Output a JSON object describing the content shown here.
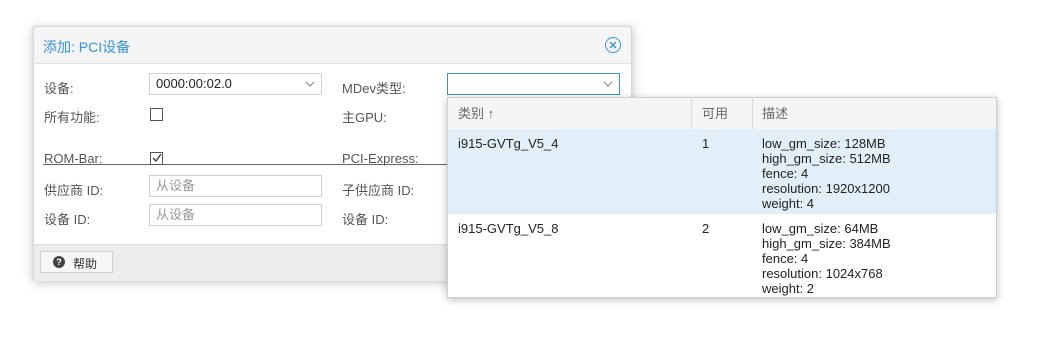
{
  "dialog": {
    "title": "添加: PCI设备",
    "fields": {
      "device_label": "设备:",
      "device_value": "0000:00:02.0",
      "all_functions_label": "所有功能:",
      "mdev_type_label": "MDev类型:",
      "primary_gpu_label": "主GPU:",
      "rom_bar_label": "ROM-Bar:",
      "pci_express_label": "PCI-Express:",
      "vendor_id_label": "供应商 ID:",
      "vendor_id_placeholder": "从设备",
      "subvendor_id_label": "子供应商 ID:",
      "device_id_label": "设备 ID:",
      "device_id_placeholder": "从设备",
      "subdevice_id_label": "设备 ID:"
    },
    "checks": {
      "all_functions": false,
      "rom_bar": true
    },
    "footer": {
      "help_label": "帮助"
    }
  },
  "mdev_dropdown": {
    "columns": [
      "类别 ↑",
      "可用",
      "描述"
    ],
    "rows": [
      {
        "type": "i915-GVTg_V5_4",
        "available": "1",
        "description": [
          "low_gm_size: 128MB",
          "high_gm_size: 512MB",
          "fence: 4",
          "resolution: 1920x1200",
          "weight: 4"
        ],
        "selected": true
      },
      {
        "type": "i915-GVTg_V5_8",
        "available": "2",
        "description": [
          "low_gm_size: 64MB",
          "high_gm_size: 384MB",
          "fence: 4",
          "resolution: 1024x768",
          "weight: 2"
        ],
        "selected": false
      }
    ]
  },
  "colors": {
    "accent": "#3892d4",
    "selected_row": "#e2eff8"
  }
}
